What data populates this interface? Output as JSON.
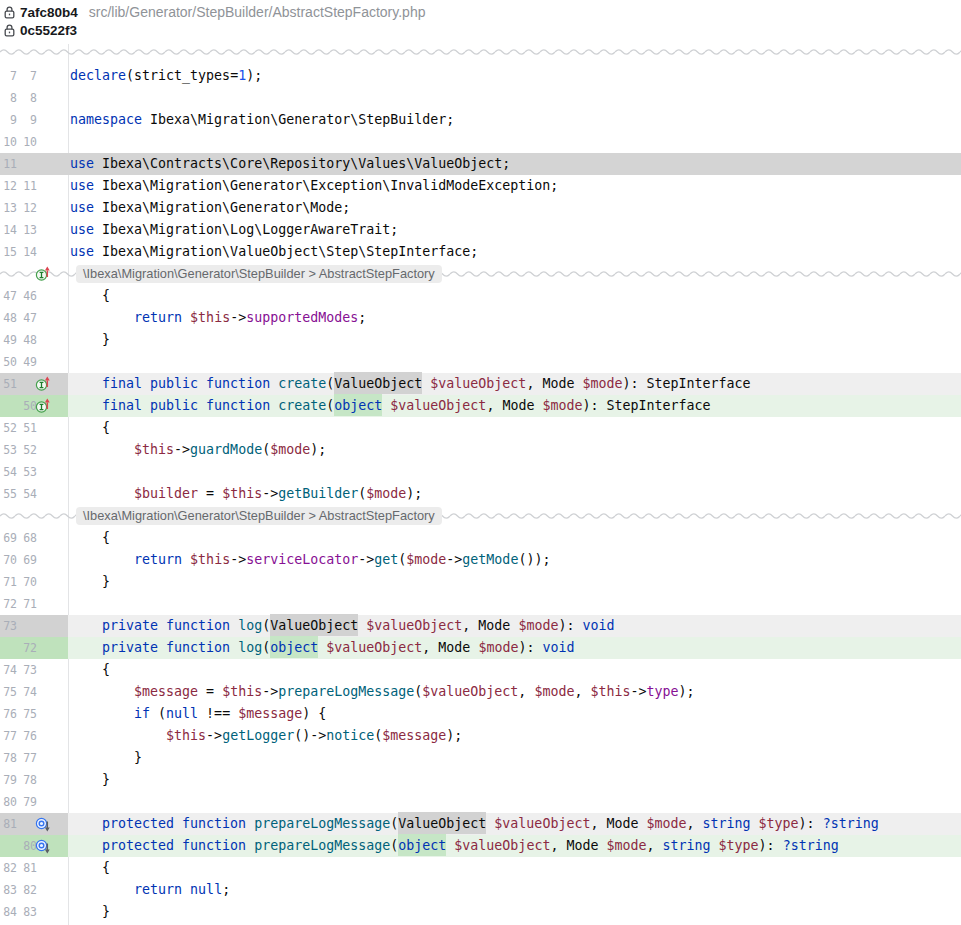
{
  "header": {
    "commits": [
      {
        "hash": "7afc80b4"
      },
      {
        "hash": "0c5522f3"
      }
    ],
    "file_path": "src/lib/Generator/StepBuilder/AbstractStepFactory.php"
  },
  "colors": {
    "keyword": "#0033b3",
    "number": "#1750eb",
    "method": "#00627a",
    "field": "#871094",
    "variable": "#8b2a42",
    "text": "#0a0a0a",
    "removed_strong": "#d4d4d4",
    "removed_light": "#efefef",
    "added_strong": "#bfe2bc",
    "added_light": "#e7f3e7",
    "added_word": "#c6e6c6"
  },
  "diff": {
    "context_label": "\\Ibexa\\Migration\\Generator\\StepBuilder > AbstractStepFactory",
    "rows": [
      {
        "old": "7",
        "new": "7",
        "seg": [
          [
            "k",
            "declare"
          ],
          [
            "t",
            "("
          ],
          [
            "t",
            "strict_types="
          ],
          [
            "n",
            "1"
          ],
          [
            "t",
            ");"
          ]
        ]
      },
      {
        "old": "8",
        "new": "8",
        "seg": []
      },
      {
        "old": "9",
        "new": "9",
        "seg": [
          [
            "k",
            "namespace"
          ],
          [
            "t",
            " Ibexa\\Migration\\Generator\\StepBuilder;"
          ]
        ]
      },
      {
        "old": "10",
        "new": "10",
        "seg": []
      },
      {
        "old": "11",
        "new": "",
        "change": "removed-full",
        "seg": [
          [
            "k",
            "use"
          ],
          [
            "t",
            " Ibexa\\Contracts\\Core\\Repository\\Values\\ValueObject;"
          ]
        ]
      },
      {
        "old": "12",
        "new": "11",
        "seg": [
          [
            "k",
            "use"
          ],
          [
            "t",
            " Ibexa\\Migration\\Generator\\Exception\\InvalidModeException;"
          ]
        ]
      },
      {
        "old": "13",
        "new": "12",
        "seg": [
          [
            "k",
            "use"
          ],
          [
            "t",
            " Ibexa\\Migration\\Generator\\Mode;"
          ]
        ]
      },
      {
        "old": "14",
        "new": "13",
        "seg": [
          [
            "k",
            "use"
          ],
          [
            "t",
            " Ibexa\\Migration\\Log\\LoggerAwareTrait;"
          ]
        ]
      },
      {
        "old": "15",
        "new": "14",
        "seg": [
          [
            "k",
            "use"
          ],
          [
            "t",
            " Ibexa\\Migration\\ValueObject\\Step\\StepInterface;"
          ]
        ]
      },
      {
        "sep": true,
        "icon": "impl"
      },
      {
        "old": "47",
        "new": "46",
        "seg": [
          [
            "t",
            "    {"
          ]
        ]
      },
      {
        "old": "48",
        "new": "47",
        "seg": [
          [
            "t",
            "        "
          ],
          [
            "k",
            "return"
          ],
          [
            "t",
            " "
          ],
          [
            "v",
            "$this"
          ],
          [
            "t",
            "->"
          ],
          [
            "f",
            "supportedModes"
          ],
          [
            "t",
            ";"
          ]
        ]
      },
      {
        "old": "49",
        "new": "48",
        "seg": [
          [
            "t",
            "    }"
          ]
        ]
      },
      {
        "old": "50",
        "new": "49",
        "seg": []
      },
      {
        "old": "51",
        "new": "",
        "change": "removed",
        "icon": "impl",
        "seg": [
          [
            "t",
            "    "
          ],
          [
            "k",
            "final public function"
          ],
          [
            "t",
            " "
          ],
          [
            "m",
            "create"
          ],
          [
            "t",
            "("
          ],
          [
            "t",
            "ValueObject",
            "del"
          ],
          [
            "t",
            " "
          ],
          [
            "v",
            "$valueObject"
          ],
          [
            "t",
            ", Mode "
          ],
          [
            "v",
            "$mode"
          ],
          [
            "t",
            "): StepInterface"
          ]
        ]
      },
      {
        "old": "",
        "new": "50",
        "change": "added",
        "icon": "impl",
        "seg": [
          [
            "t",
            "    "
          ],
          [
            "k",
            "final public function"
          ],
          [
            "t",
            " "
          ],
          [
            "m",
            "create"
          ],
          [
            "t",
            "("
          ],
          [
            "k",
            "object",
            "add"
          ],
          [
            "t",
            " "
          ],
          [
            "v",
            "$valueObject"
          ],
          [
            "t",
            ", Mode "
          ],
          [
            "v",
            "$mode"
          ],
          [
            "t",
            "): StepInterface"
          ]
        ]
      },
      {
        "old": "52",
        "new": "51",
        "seg": [
          [
            "t",
            "    {"
          ]
        ]
      },
      {
        "old": "53",
        "new": "52",
        "seg": [
          [
            "t",
            "        "
          ],
          [
            "v",
            "$this"
          ],
          [
            "t",
            "->"
          ],
          [
            "m",
            "guardMode"
          ],
          [
            "t",
            "("
          ],
          [
            "v",
            "$mode"
          ],
          [
            "t",
            ");"
          ]
        ]
      },
      {
        "old": "54",
        "new": "53",
        "seg": []
      },
      {
        "old": "55",
        "new": "54",
        "seg": [
          [
            "t",
            "        "
          ],
          [
            "v",
            "$builder"
          ],
          [
            "t",
            " = "
          ],
          [
            "v",
            "$this"
          ],
          [
            "t",
            "->"
          ],
          [
            "m",
            "getBuilder"
          ],
          [
            "t",
            "("
          ],
          [
            "v",
            "$mode"
          ],
          [
            "t",
            ");"
          ]
        ]
      },
      {
        "sep": true,
        "icon": null
      },
      {
        "old": "69",
        "new": "68",
        "seg": [
          [
            "t",
            "    {"
          ]
        ]
      },
      {
        "old": "70",
        "new": "69",
        "seg": [
          [
            "t",
            "        "
          ],
          [
            "k",
            "return"
          ],
          [
            "t",
            " "
          ],
          [
            "v",
            "$this"
          ],
          [
            "t",
            "->"
          ],
          [
            "f",
            "serviceLocator"
          ],
          [
            "t",
            "->"
          ],
          [
            "m",
            "get"
          ],
          [
            "t",
            "("
          ],
          [
            "v",
            "$mode"
          ],
          [
            "t",
            "->"
          ],
          [
            "m",
            "getMode"
          ],
          [
            "t",
            "());"
          ]
        ]
      },
      {
        "old": "71",
        "new": "70",
        "seg": [
          [
            "t",
            "    }"
          ]
        ]
      },
      {
        "old": "72",
        "new": "71",
        "seg": []
      },
      {
        "old": "73",
        "new": "",
        "change": "removed",
        "seg": [
          [
            "t",
            "    "
          ],
          [
            "k",
            "private function"
          ],
          [
            "t",
            " "
          ],
          [
            "m",
            "log"
          ],
          [
            "t",
            "("
          ],
          [
            "t",
            "ValueObject",
            "del"
          ],
          [
            "t",
            " "
          ],
          [
            "v",
            "$valueObject"
          ],
          [
            "t",
            ", Mode "
          ],
          [
            "v",
            "$mode"
          ],
          [
            "t",
            "): "
          ],
          [
            "k",
            "void"
          ]
        ]
      },
      {
        "old": "",
        "new": "72",
        "change": "added",
        "seg": [
          [
            "t",
            "    "
          ],
          [
            "k",
            "private function"
          ],
          [
            "t",
            " "
          ],
          [
            "m",
            "log"
          ],
          [
            "t",
            "("
          ],
          [
            "k",
            "object",
            "add"
          ],
          [
            "t",
            " "
          ],
          [
            "v",
            "$valueObject"
          ],
          [
            "t",
            ", Mode "
          ],
          [
            "v",
            "$mode"
          ],
          [
            "t",
            "): "
          ],
          [
            "k",
            "void"
          ]
        ]
      },
      {
        "old": "74",
        "new": "73",
        "seg": [
          [
            "t",
            "    {"
          ]
        ]
      },
      {
        "old": "75",
        "new": "74",
        "seg": [
          [
            "t",
            "        "
          ],
          [
            "v",
            "$message"
          ],
          [
            "t",
            " = "
          ],
          [
            "v",
            "$this"
          ],
          [
            "t",
            "->"
          ],
          [
            "m",
            "prepareLogMessage"
          ],
          [
            "t",
            "("
          ],
          [
            "v",
            "$valueObject"
          ],
          [
            "t",
            ", "
          ],
          [
            "v",
            "$mode"
          ],
          [
            "t",
            ", "
          ],
          [
            "v",
            "$this"
          ],
          [
            "t",
            "->"
          ],
          [
            "f",
            "type"
          ],
          [
            "t",
            ");"
          ]
        ]
      },
      {
        "old": "76",
        "new": "75",
        "seg": [
          [
            "t",
            "        "
          ],
          [
            "k",
            "if"
          ],
          [
            "t",
            " ("
          ],
          [
            "k",
            "null"
          ],
          [
            "t",
            " !== "
          ],
          [
            "v",
            "$message"
          ],
          [
            "t",
            ") {"
          ]
        ]
      },
      {
        "old": "77",
        "new": "76",
        "seg": [
          [
            "t",
            "            "
          ],
          [
            "v",
            "$this"
          ],
          [
            "t",
            "->"
          ],
          [
            "m",
            "getLogger"
          ],
          [
            "t",
            "()->"
          ],
          [
            "m",
            "notice"
          ],
          [
            "t",
            "("
          ],
          [
            "v",
            "$message"
          ],
          [
            "t",
            ");"
          ]
        ]
      },
      {
        "old": "78",
        "new": "77",
        "seg": [
          [
            "t",
            "        }"
          ]
        ]
      },
      {
        "old": "79",
        "new": "78",
        "seg": [
          [
            "t",
            "    }"
          ]
        ]
      },
      {
        "old": "80",
        "new": "79",
        "seg": []
      },
      {
        "old": "81",
        "new": "",
        "change": "removed",
        "icon": "override",
        "seg": [
          [
            "t",
            "    "
          ],
          [
            "k",
            "protected function"
          ],
          [
            "t",
            " "
          ],
          [
            "m",
            "prepareLogMessage"
          ],
          [
            "t",
            "("
          ],
          [
            "t",
            "ValueObject",
            "del"
          ],
          [
            "t",
            " "
          ],
          [
            "v",
            "$valueObject"
          ],
          [
            "t",
            ", Mode "
          ],
          [
            "v",
            "$mode"
          ],
          [
            "t",
            ", "
          ],
          [
            "k",
            "string"
          ],
          [
            "t",
            " "
          ],
          [
            "v",
            "$type"
          ],
          [
            "t",
            "): "
          ],
          [
            "k",
            "?string"
          ]
        ]
      },
      {
        "old": "",
        "new": "80",
        "change": "added",
        "icon": "override",
        "seg": [
          [
            "t",
            "    "
          ],
          [
            "k",
            "protected function"
          ],
          [
            "t",
            " "
          ],
          [
            "m",
            "prepareLogMessage"
          ],
          [
            "t",
            "("
          ],
          [
            "k",
            "object",
            "add"
          ],
          [
            "t",
            " "
          ],
          [
            "v",
            "$valueObject"
          ],
          [
            "t",
            ", Mode "
          ],
          [
            "v",
            "$mode"
          ],
          [
            "t",
            ", "
          ],
          [
            "k",
            "string"
          ],
          [
            "t",
            " "
          ],
          [
            "v",
            "$type"
          ],
          [
            "t",
            "): "
          ],
          [
            "k",
            "?string"
          ]
        ]
      },
      {
        "old": "82",
        "new": "81",
        "seg": [
          [
            "t",
            "    {"
          ]
        ]
      },
      {
        "old": "83",
        "new": "82",
        "seg": [
          [
            "t",
            "        "
          ],
          [
            "k",
            "return"
          ],
          [
            "t",
            " "
          ],
          [
            "k",
            "null"
          ],
          [
            "t",
            ";"
          ]
        ]
      },
      {
        "old": "84",
        "new": "83",
        "seg": [
          [
            "t",
            "    }"
          ]
        ]
      }
    ]
  }
}
